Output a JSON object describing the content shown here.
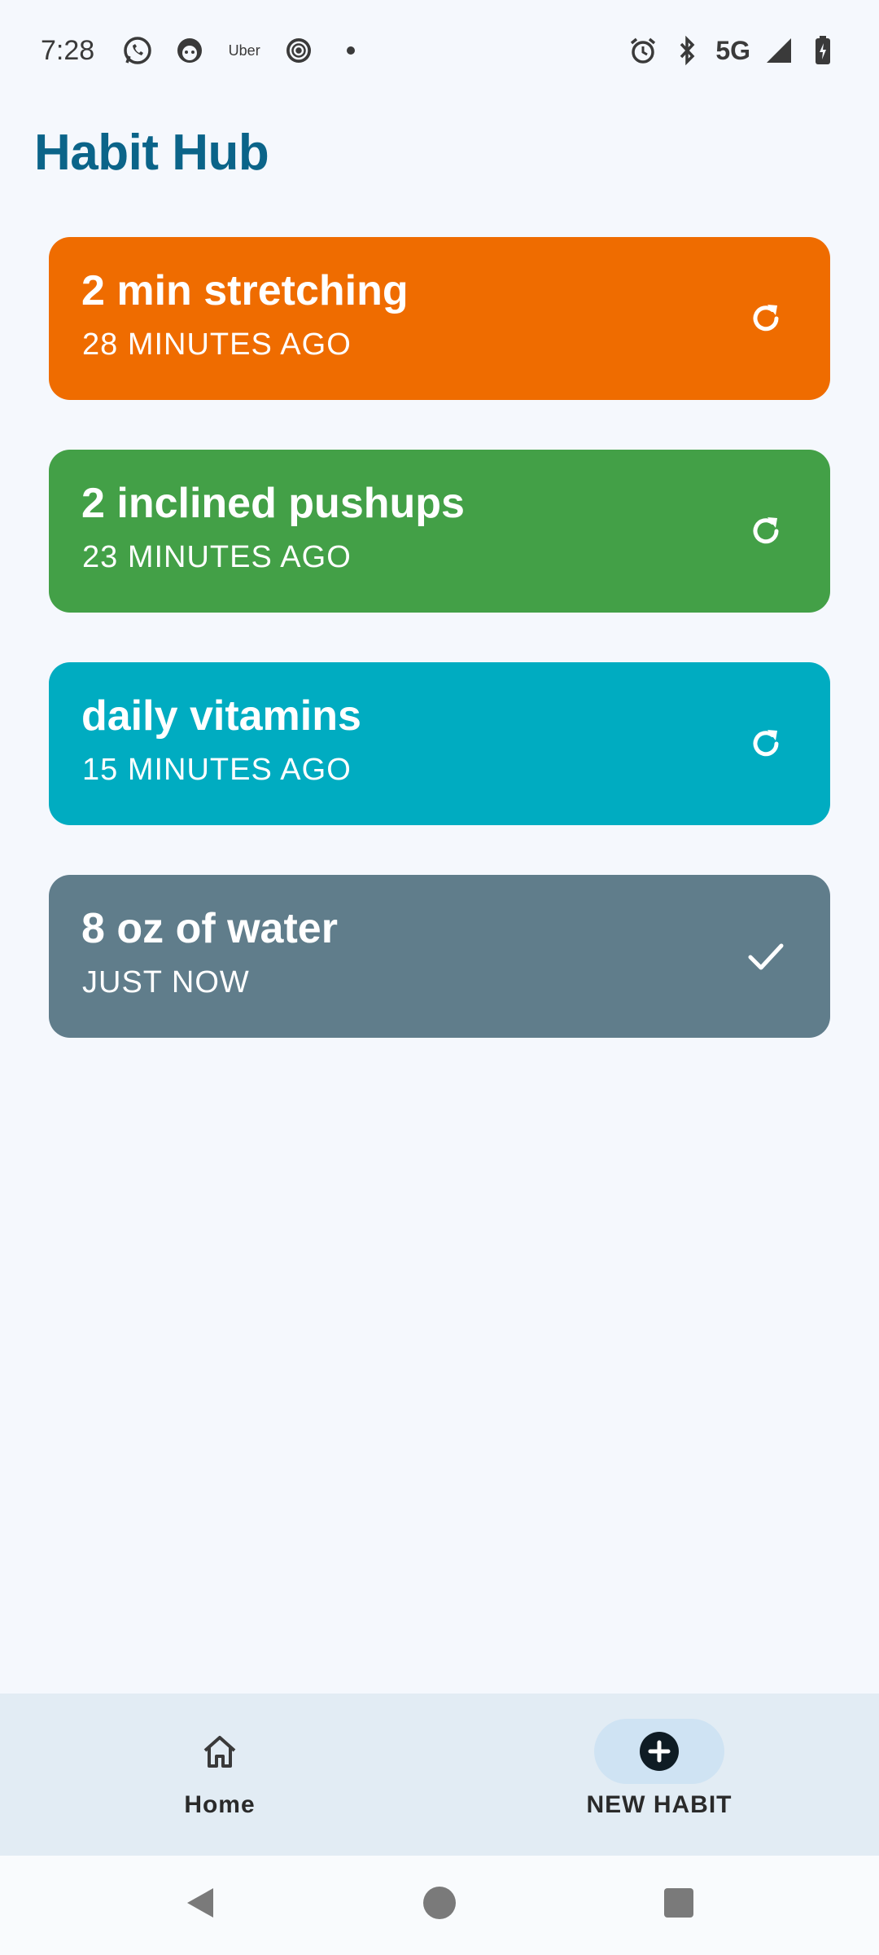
{
  "status_bar": {
    "time": "7:28",
    "uber_label": "Uber",
    "network": "5G",
    "icons": [
      "whatsapp-icon",
      "face-app-icon",
      "uber-icon",
      "target-icon",
      "dot-icon",
      "alarm-icon",
      "bluetooth-icon",
      "signal-icon",
      "battery-icon"
    ]
  },
  "app": {
    "title": "Habit Hub"
  },
  "habits": [
    {
      "name": "2 min stretching",
      "time": "28 MINUTES AGO",
      "color": "#ef6c00",
      "action_icon": "refresh-icon"
    },
    {
      "name": "2 inclined pushups",
      "time": "23 MINUTES AGO",
      "color": "#43a047",
      "action_icon": "refresh-icon"
    },
    {
      "name": "daily vitamins",
      "time": "15 MINUTES AGO",
      "color": "#00acc1",
      "action_icon": "refresh-icon"
    },
    {
      "name": "8 oz of water",
      "time": "JUST NOW",
      "color": "#607d8b",
      "action_icon": "check-icon"
    }
  ],
  "bottom_nav": {
    "home_label": "Home",
    "new_habit_label": "NEW HABIT"
  },
  "colors": {
    "title": "#0b6489",
    "background": "#f5f8fd",
    "nav_background": "#e2ecf4",
    "nav_active_pill": "#cfe3f3"
  }
}
